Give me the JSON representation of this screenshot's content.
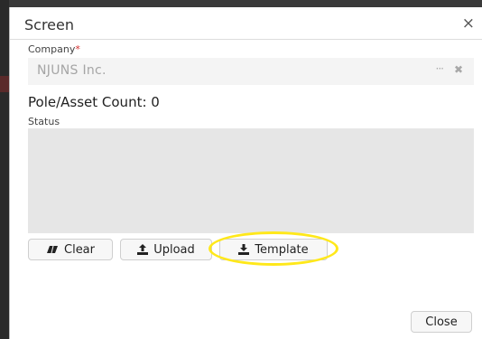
{
  "dialog": {
    "title": "Screen",
    "close_glyph": "×"
  },
  "company": {
    "label": "Company",
    "required_mark": "*",
    "value": "NJUNS Inc.",
    "more_glyph": "···",
    "clear_glyph": "✖"
  },
  "pole_count": {
    "text": "Pole/Asset Count: 0"
  },
  "status": {
    "label": "Status"
  },
  "toolbar": {
    "clear_label": "Clear",
    "upload_label": "Upload",
    "template_label": "Template",
    "clear_icon": "eraser-icon",
    "upload_icon": "upload-icon",
    "template_icon": "download-icon"
  },
  "footer": {
    "close_label": "Close"
  },
  "colors": {
    "required": "#d32f2f",
    "highlight": "#ffe81a",
    "field_bg": "#f4f4f4",
    "status_bg": "#e6e6e6"
  }
}
